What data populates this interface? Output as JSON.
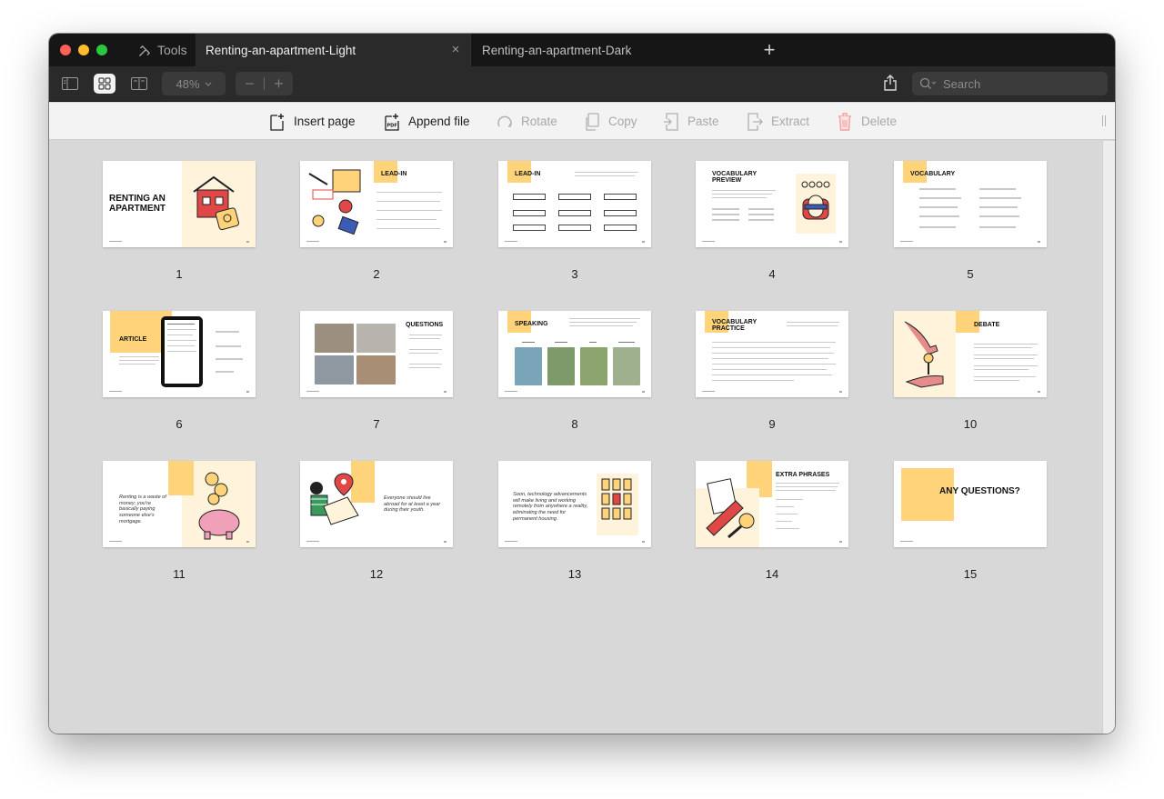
{
  "tabs": {
    "tools_label": "Tools",
    "active": "Renting-an-apartment-Light",
    "inactive": "Renting-an-apartment-Dark",
    "close_glyph": "×",
    "new_tab_glyph": "+"
  },
  "viewbar": {
    "zoom": "48%",
    "zoom_out": "−",
    "zoom_in": "+",
    "search_placeholder": "Search"
  },
  "actions": {
    "insert_page": "Insert page",
    "append_file": "Append file",
    "rotate": "Rotate",
    "copy": "Copy",
    "paste": "Paste",
    "extract": "Extract",
    "delete": "Delete"
  },
  "pages": [
    {
      "number": "1",
      "title": "RENTING AN APARTMENT"
    },
    {
      "number": "2",
      "title": "LEAD-IN"
    },
    {
      "number": "3",
      "title": "LEAD-IN"
    },
    {
      "number": "4",
      "title": "VOCABULARY PREVIEW"
    },
    {
      "number": "5",
      "title": "VOCABULARY"
    },
    {
      "number": "6",
      "title": "ARTICLE"
    },
    {
      "number": "7",
      "title": "QUESTIONS"
    },
    {
      "number": "8",
      "title": "SPEAKING"
    },
    {
      "number": "9",
      "title": "VOCABULARY PRACTICE"
    },
    {
      "number": "10",
      "title": "DEBATE"
    },
    {
      "number": "11",
      "text": "Renting is a waste of money; you're basically paying someone else's mortgage."
    },
    {
      "number": "12",
      "text": "Everyone should live abroad for at least a year during their youth."
    },
    {
      "number": "13",
      "text": "Soon, technology advancements will make living and working remotely from anywhere a reality, eliminating the need for permanent housing."
    },
    {
      "number": "14",
      "title": "EXTRA PHRASES"
    },
    {
      "number": "15",
      "title": "ANY QUESTIONS?"
    }
  ],
  "colors": {
    "accent_yellow": "#ffd37a",
    "cream": "#fff3dc",
    "delete_red": "#f2a0a0"
  }
}
